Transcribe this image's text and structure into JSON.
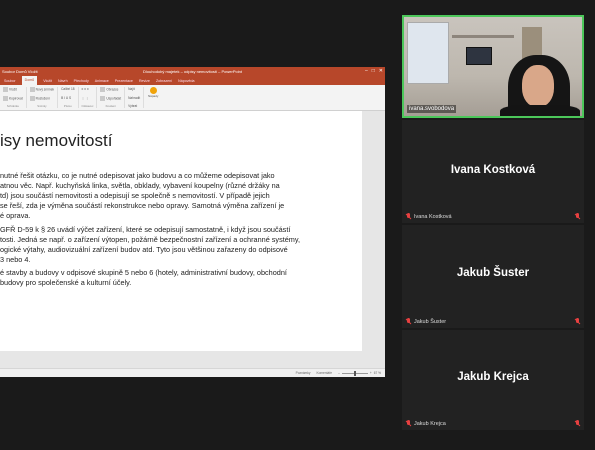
{
  "powerpoint": {
    "window_title": "Dlouhodobý majetek – odpisy nemovitostí – PowerPoint",
    "quick_access": "Soubor  Domů  Vložit",
    "tabs": [
      "Soubor",
      "Domů",
      "Vložit",
      "Návrh",
      "Přechody",
      "Animace",
      "Prezentace",
      "Revize",
      "Zobrazení",
      "Nápověda"
    ],
    "active_tab": "Domů",
    "ribbon": {
      "groups": [
        {
          "label": "Schránka",
          "rows": [
            "Vložit",
            "Kopírovat"
          ]
        },
        {
          "label": "Snímky",
          "rows": [
            "Nový snímek",
            "Rozložení"
          ]
        },
        {
          "label": "Písmo",
          "rows": [
            "Calibri  18",
            "B I U S"
          ]
        },
        {
          "label": "Odstavec",
          "rows": [
            "≡ ≡ ≡",
            "⋮ ⋮"
          ]
        },
        {
          "label": "Kreslení",
          "rows": [
            "Obrazce",
            "Uspořádat"
          ]
        },
        {
          "label": "Úpravy",
          "rows": [
            "Najít",
            "Nahradit",
            "Vybrat"
          ]
        }
      ],
      "design_ideas": "Nápady"
    },
    "slide": {
      "title": "isy nemovitostí",
      "paragraphs": [
        {
          "lines": [
            "nutné řešit otázku, co je nutné odepisovat jako budovu a co můžeme odepisovat jako",
            "atnou věc.  Např. kuchyňská linka, světla, obklady, vybavení koupelny (různé držáky na",
            "td) jsou součástí nemovitosti a odepisují se společně s nemovitostí. V případě jejich",
            "se řeší, zda je výměna součástí rekonstrukce nebo opravy. Samotná výměna zařízení je",
            "é oprava."
          ]
        },
        {
          "lines": [
            "GFŘ D-59 k § 26 uvádí výčet zařízení, které se odepisují samostatně, i když jsou součástí",
            "tosti. Jedná se např. o zařízení výtopen, požárně bezpečnostní zařízení a ochranné systémy,",
            "ogické výtahy, audiovizuální zařízení budov atd. Tyto jsou většinou zařazeny do odpisové",
            " 3 nebo 4."
          ]
        },
        {
          "lines": [
            "é stavby a budovy v odpisové skupině 5 nebo 6 (hotely, administrativní budovy, obchodní",
            "budovy pro společenské a kulturní účely."
          ]
        }
      ]
    },
    "statusbar": {
      "notes": "Poznámky",
      "comments": "Komentáře",
      "zoom": "67 %"
    }
  },
  "participants": [
    {
      "name": "ivana.svobodova",
      "type": "video"
    },
    {
      "name": "Ivana Kostková",
      "type": "avatar"
    },
    {
      "name": "Jakub Šuster",
      "type": "avatar"
    },
    {
      "name": "Jakub Krejca",
      "type": "avatar"
    }
  ],
  "colors": {
    "ppt_accent": "#b7472a",
    "active_speaker_border": "#4cc75a",
    "muted_mic": "#e84040",
    "background": "#1a1a1a"
  }
}
